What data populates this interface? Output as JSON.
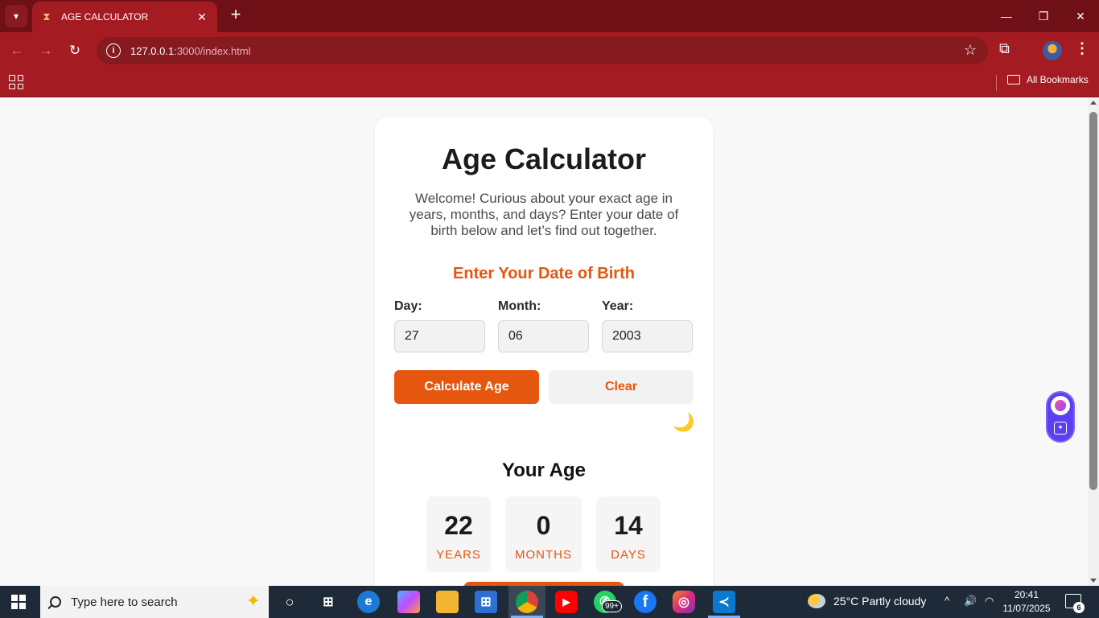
{
  "browser": {
    "tab_title": "AGE CALCULATOR",
    "url_host": "127.0.0.1",
    "url_rest": ":3000/index.html",
    "bookmarks_label": "All Bookmarks"
  },
  "page": {
    "title": "Age Calculator",
    "intro": "Welcome! Curious about your exact age in years, months, and days? Enter your date of birth below and let’s find out together.",
    "dob_heading": "Enter Your Date of Birth",
    "fields": {
      "day_label": "Day:",
      "day_value": "27",
      "month_label": "Month:",
      "month_value": "06",
      "year_label": "Year:",
      "year_value": "2003"
    },
    "calculate_label": "Calculate Age",
    "clear_label": "Clear",
    "theme_toggle": "🌙",
    "age_heading": "Your Age",
    "age": {
      "years": "22",
      "years_unit": "YEARS",
      "months": "0",
      "months_unit": "MONTHS",
      "days": "14",
      "days_unit": "DAYS"
    }
  },
  "taskbar": {
    "search_placeholder": "Type here to search",
    "whatsapp_badge": "99+",
    "weather": "25°C  Partly cloudy",
    "time": "20:41",
    "date": "11/07/2025",
    "notifications": "6"
  },
  "colors": {
    "accent": "#e5560f",
    "chrome": "#a51b22",
    "tabbar": "#6e1016"
  }
}
